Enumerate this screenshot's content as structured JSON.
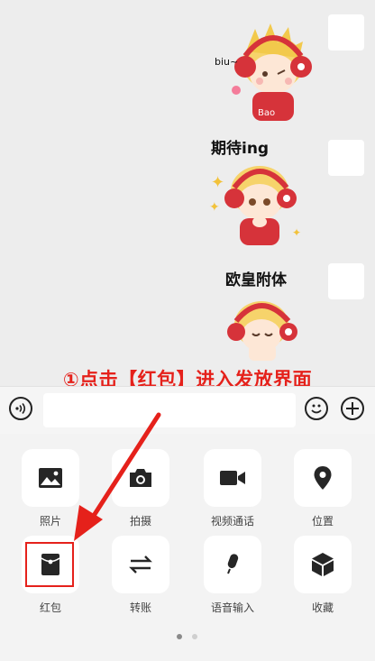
{
  "chat": {
    "sticker_captions": [
      "biu~",
      "期待ing",
      "欧皇附体"
    ],
    "sticker_badge": "Bao"
  },
  "instruction": "①点击【红包】进入发放界面",
  "input_bar": {
    "text_value": ""
  },
  "panel": {
    "row1": [
      {
        "label": "照片",
        "icon": "image-icon"
      },
      {
        "label": "拍摄",
        "icon": "camera-icon"
      },
      {
        "label": "视频通话",
        "icon": "video-call-icon"
      },
      {
        "label": "位置",
        "icon": "location-pin-icon"
      }
    ],
    "row2": [
      {
        "label": "红包",
        "icon": "red-packet-icon"
      },
      {
        "label": "转账",
        "icon": "transfer-icon"
      },
      {
        "label": "语音输入",
        "icon": "microphone-icon"
      },
      {
        "label": "收藏",
        "icon": "favorites-cube-icon"
      }
    ],
    "page_indicator": {
      "current": 1,
      "total": 2
    }
  },
  "colors": {
    "annotation_red": "#e5211b",
    "chat_bg": "#ededed",
    "panel_bg": "#f3f3f3"
  }
}
